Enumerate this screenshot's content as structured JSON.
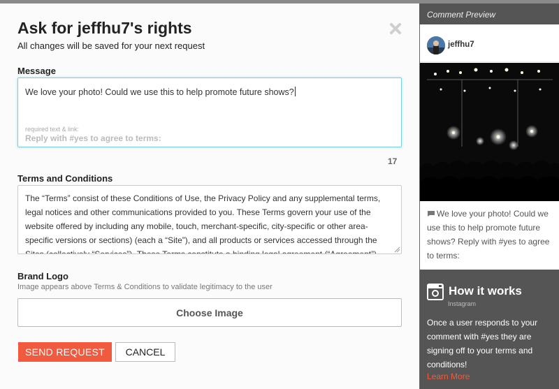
{
  "modal": {
    "title": "Ask for jeffhu7's rights",
    "subtitle": "All changes will be saved for your next request"
  },
  "message": {
    "label": "Message",
    "value": "We love your photo! Could we use this to help promote future shows?",
    "required_label": "required text & link:",
    "required_text": "Reply with #yes to agree to terms:",
    "char_count": "17"
  },
  "terms": {
    "label": "Terms and Conditions",
    "text": "The “Terms” consist of these Conditions of Use, the Privacy Policy and any supplemental terms, legal notices and other communications provided to you. These Terms govern your use of the website offered by including any mobile, touch, merchant-specific, city-specific or other area-specific versions or sections) (each a “Site”), and all products or services accessed through the Sites (collectively “Services”). These Terms constitute a binding legal agreement (“Agreement”)"
  },
  "logo": {
    "label": "Brand Logo",
    "hint": "Image appears above Terms & Conditions to validate legitimacy to the user",
    "choose_label": "Choose Image"
  },
  "actions": {
    "send_label": "SEND REQUEST",
    "cancel_label": "CANCEL"
  },
  "preview": {
    "heading": "Comment Preview",
    "username": "jeffhu7",
    "comment": "We love your photo! Could we use this to help promote future shows? Reply with #yes to agree to terms:"
  },
  "how_it_works": {
    "title": "How it works",
    "subtitle": "Instagram",
    "description": "Once a user responds to your comment with #yes they are signing off to your terms and conditions!",
    "learn_more": "Learn More"
  },
  "colors": {
    "accent": "#f05a3e",
    "focus_border": "#7fd0e0",
    "panel_dark": "#555555"
  }
}
